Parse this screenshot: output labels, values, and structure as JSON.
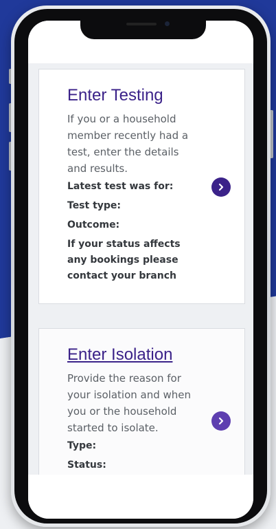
{
  "testing": {
    "title": "Enter Testing",
    "description": "If you or a household member recently had a test, enter the details and results.",
    "fields": [
      "Latest test was for:",
      "Test type:",
      "Outcome:"
    ],
    "notice": "If your status affects any bookings please contact your branch",
    "arrow_icon": "chevron-right-icon"
  },
  "isolation": {
    "title": "Enter Isolation",
    "description": "Provide the reason for your isolation and when you or the household started to isolate.",
    "fields": [
      "Type:",
      "Status:"
    ],
    "arrow_icon": "chevron-right-icon"
  },
  "colors": {
    "brand_blue": "#20399a",
    "accent_purple": "#3b2289",
    "text_grey": "#5b6066",
    "background": "#eef0f3"
  }
}
